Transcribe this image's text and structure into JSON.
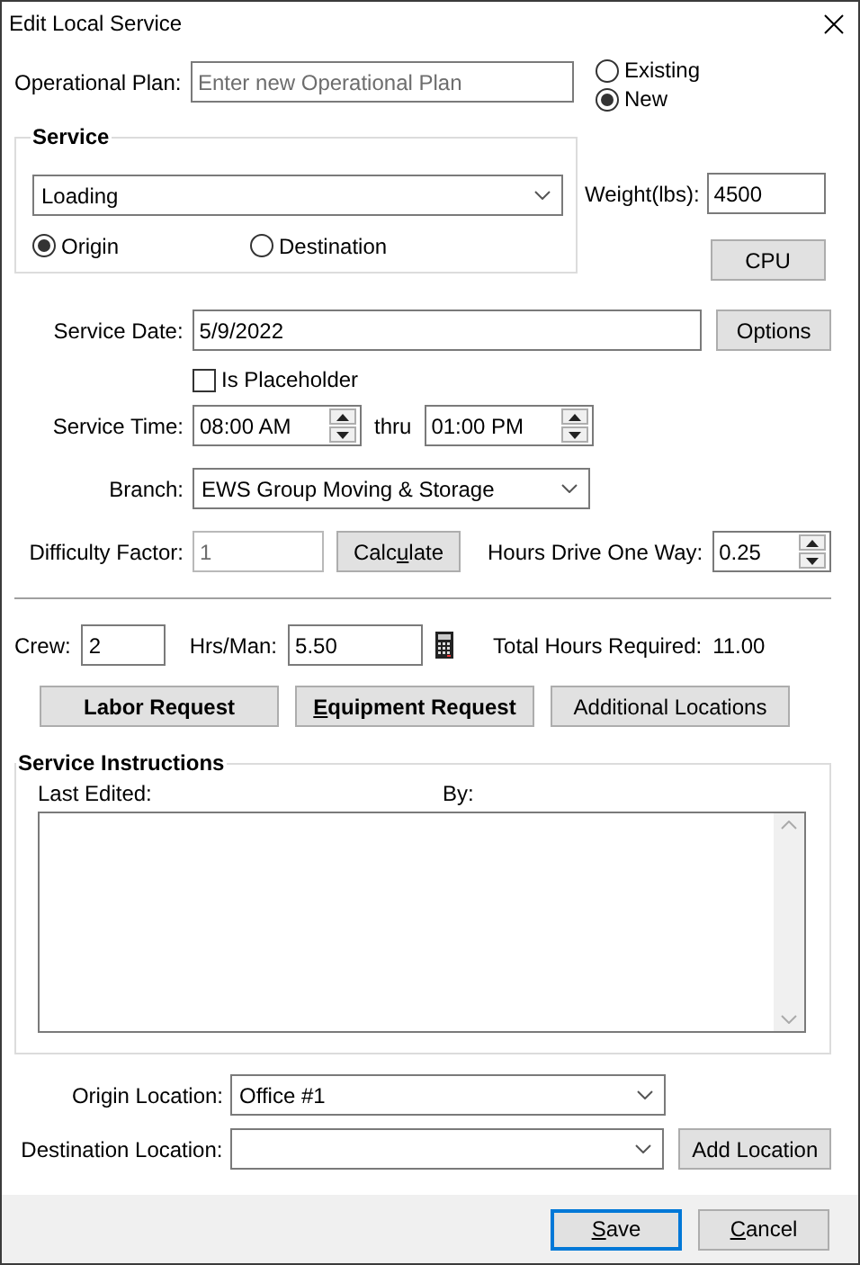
{
  "window": {
    "title": "Edit Local Service"
  },
  "operational_plan": {
    "label": "Operational Plan:",
    "placeholder": "Enter new Operational Plan",
    "options": [
      {
        "label": "Existing",
        "selected": false
      },
      {
        "label": "New",
        "selected": true
      }
    ]
  },
  "service": {
    "title": "Service",
    "value": "Loading",
    "endpoints": [
      {
        "label": "Origin",
        "selected": true
      },
      {
        "label": "Destination",
        "selected": false
      }
    ]
  },
  "weight": {
    "label": "Weight(lbs):",
    "value": "4500"
  },
  "cpu_button": "CPU",
  "service_date": {
    "label": "Service Date:",
    "value": "5/9/2022"
  },
  "options_button": "Options",
  "is_placeholder": {
    "label": "Is Placeholder",
    "checked": false
  },
  "service_time": {
    "label": "Service Time:",
    "start": "08:00 AM",
    "separator": "thru",
    "end": "01:00 PM"
  },
  "branch": {
    "label": "Branch:",
    "value": "EWS Group Moving & Storage"
  },
  "difficulty": {
    "label": "Difficulty Factor:",
    "value": "1"
  },
  "calculate_button": {
    "before": "Calc",
    "key": "u",
    "after": "late"
  },
  "hours_drive": {
    "label": "Hours Drive One Way:",
    "value": "0.25"
  },
  "crew": {
    "label": "Crew:",
    "value": "2"
  },
  "hrs_per_man": {
    "label": "Hrs/Man:",
    "value": "5.50"
  },
  "total_hours": {
    "label": "Total Hours Required:",
    "value": "11.00"
  },
  "request_buttons": [
    {
      "before": "Labor Request",
      "bold": true
    },
    {
      "key": "E",
      "after": "quipment Request",
      "bold": true
    },
    {
      "before": "Additional Locations",
      "bold": false
    }
  ],
  "instructions": {
    "title": "Service Instructions",
    "last_edited_label": "Last Edited:",
    "by_label": "By:"
  },
  "origin_location": {
    "label": "Origin Location:",
    "value": "Office #1"
  },
  "destination_location": {
    "label": "Destination Location:"
  },
  "add_location_button": "Add Location",
  "footer_buttons": [
    {
      "key": "S",
      "after": "ave",
      "default": true
    },
    {
      "key": "C",
      "after": "ancel",
      "default": false
    }
  ]
}
